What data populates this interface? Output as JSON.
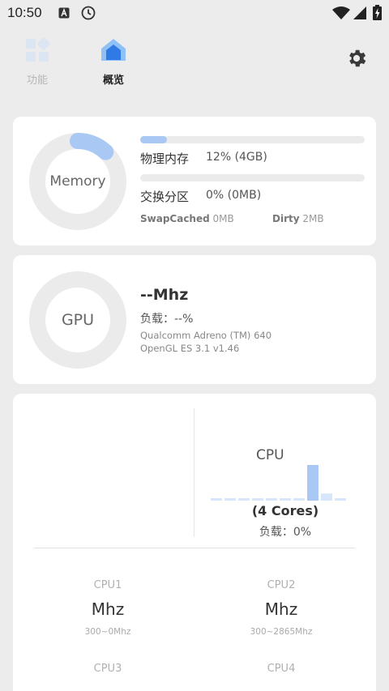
{
  "status": {
    "time": "10:50"
  },
  "nav": {
    "tabs": [
      {
        "label": "功能"
      },
      {
        "label": "概览"
      }
    ]
  },
  "memory": {
    "ring_label": "Memory",
    "physical_label": "物理内存",
    "physical_value": "12% (4GB)",
    "physical_percent": 12,
    "swap_label": "交换分区",
    "swap_value": "0% (0MB)",
    "swap_percent": 0,
    "swapcached_label": "SwapCached",
    "swapcached_value": "0MB",
    "dirty_label": "Dirty",
    "dirty_value": "2MB"
  },
  "gpu": {
    "ring_label": "GPU",
    "freq": "--Mhz",
    "load": "负载：--%",
    "model": "Qualcomm Adreno (TM) 640",
    "gl": "OpenGL ES 3.1 v1.46"
  },
  "cpu": {
    "title": "CPU",
    "cores": "(4 Cores)",
    "load": "负载：0%",
    "history_bars": [
      0,
      0,
      0,
      0,
      0,
      0,
      0,
      100,
      20,
      0
    ],
    "core_list": [
      {
        "name": "CPU1",
        "freq": "Mhz",
        "range": "300~0Mhz"
      },
      {
        "name": "CPU2",
        "freq": "Mhz",
        "range": "300~2865Mhz"
      },
      {
        "name": "CPU3",
        "freq": "",
        "range": ""
      },
      {
        "name": "CPU4",
        "freq": "",
        "range": ""
      }
    ]
  },
  "colors": {
    "accent": "#4a8ff0",
    "accent_light": "#a9c8f4",
    "ring_track": "#ebebeb"
  }
}
